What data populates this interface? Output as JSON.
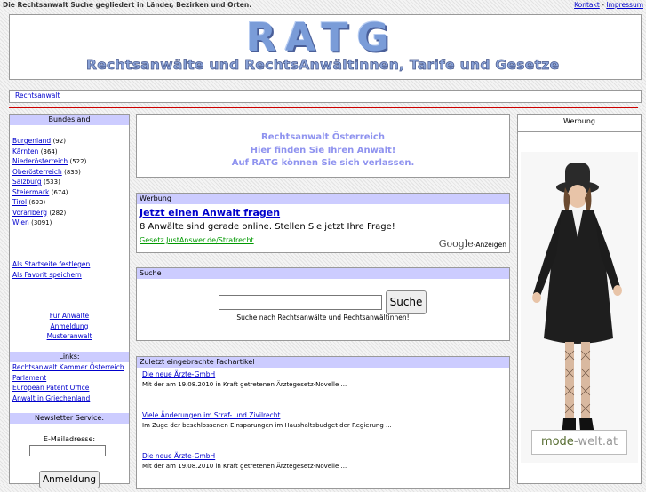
{
  "top": {
    "tagline": "Die Rechtsanwalt Suche gegliedert in Länder, Bezirken und Orten.",
    "kontakt": "Kontakt",
    "separator": " - ",
    "impressum": "Impressum"
  },
  "logo": {
    "text": "RATG",
    "subtitle": "Rechtsanwälte und RechtsAnwältinnen, Tarife und Gesetze"
  },
  "breadcrumb": {
    "link": "Rechtsanwalt"
  },
  "colors": {
    "accent_line": "#cc0000",
    "header_bg": "#ccccff",
    "link": "#0000cc",
    "green": "#009900"
  },
  "left": {
    "bundesland_header": "Bundesland",
    "states": [
      {
        "name": "Burgenland",
        "count": "(92)"
      },
      {
        "name": "Kärnten",
        "count": "(364)"
      },
      {
        "name": "Niederösterreich",
        "count": "(522)"
      },
      {
        "name": "Oberösterreich",
        "count": "(835)"
      },
      {
        "name": "Salzburg",
        "count": "(533)"
      },
      {
        "name": "Steiermark",
        "count": "(674)"
      },
      {
        "name": "Tirol",
        "count": "(693)"
      },
      {
        "name": "Vorarlberg",
        "count": "(282)"
      },
      {
        "name": "Wien",
        "count": "(3091)"
      }
    ],
    "startseite": "Als Startseite festlegen",
    "favorit": "Als Favorit speichern",
    "fuer_anwaelte": "Für Anwälte",
    "anmeldung": "Anmeldung",
    "musteranwalt": "Musteranwalt",
    "links_header": "Links:",
    "links": [
      "Rechtsanwalt Kammer Österreich",
      "Parlament",
      "European Patent Office",
      "Anwalt in Griechenland"
    ],
    "newsletter_header": "Newsletter Service:",
    "email_label": "E-Mailadresse:",
    "email_value": "",
    "anmeldung_button": "Anmeldung"
  },
  "center": {
    "intro_line1": "Rechtsanwalt Österreich",
    "intro_line2": "Hier finden Sie Ihren Anwalt!",
    "intro_line3": "Auf RATG können Sie sich verlassen.",
    "werbung_header": "Werbung",
    "ad_title": "Jetzt einen Anwalt fragen",
    "ad_text": "8 Anwälte sind gerade online. Stellen Sie jetzt Ihre Frage!",
    "ad_url": "Gesetz.JustAnswer.de/Strafrecht",
    "google_logo": "Google",
    "google_anzeigen": "-Anzeigen",
    "suche_header": "Suche",
    "search_value": "",
    "search_button": "Suche",
    "search_hint": "Suche nach Rechtsanwälte und Rechtsanwältinnen!",
    "articles_header": "Zuletzt eingebrachte Fachartikel",
    "articles": [
      {
        "title": "Die neue Ärzte-GmbH",
        "text": "Mit der am 19.08.2010 in Kraft getretenen Ärztegesetz-Novelle ..."
      },
      {
        "title": "Viele Änderungen im Straf- und Zivilrecht",
        "text": "Im Zuge der beschlossenen Einsparungen im Haushaltsbudget der Regierung ..."
      },
      {
        "title": "Die neue Ärzte-GmbH",
        "text": "Mit der am 19.08.2010 in Kraft getretenen Ärztegesetz-Novelle ..."
      }
    ]
  },
  "right": {
    "werbung_header": "Werbung",
    "banner_brand_a": "mode",
    "banner_brand_b": "-welt.at"
  }
}
